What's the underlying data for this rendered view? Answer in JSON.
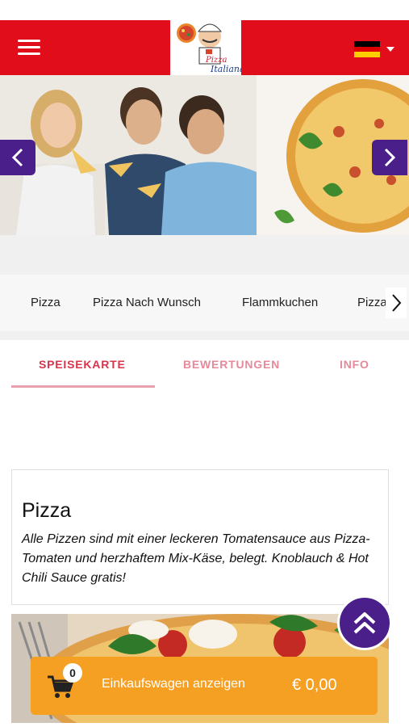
{
  "header": {
    "menu_icon": "hamburger-icon",
    "logo_text": "Pizza Italiana",
    "language": {
      "flag": "german-flag-icon",
      "colors": [
        "#000000",
        "#dd0000",
        "#ffce00"
      ]
    },
    "brand_color": "#e20d1a"
  },
  "hero": {
    "prev_icon": "chevron-left-icon",
    "next_icon": "chevron-right-icon",
    "accent": "#4a1f8a"
  },
  "categories": {
    "items": [
      "Pizza",
      "Pizza Nach Wunsch",
      "Flammkuchen",
      "Pizza g"
    ],
    "next_icon": "chevron-right-icon"
  },
  "tabs": {
    "items": [
      "SPEISEKARTE",
      "BEWERTUNGEN",
      "INFO"
    ],
    "active": "SPEISEKARTE"
  },
  "section": {
    "title": "Pizza",
    "description": "Alle Pizzen sind mit einer leckeren Tomatensauce aus Pizza-Tomaten und herzhaftem Mix-Käse, belegt. Knoblauch & Hot Chili Sauce gratis!"
  },
  "scroll_top_icon": "double-chevron-up-icon",
  "cart": {
    "count": "0",
    "label": "Einkaufswagen anzeigen",
    "total": "€ 0,00",
    "icon": "shopping-cart-icon",
    "color": "#f5a023"
  }
}
